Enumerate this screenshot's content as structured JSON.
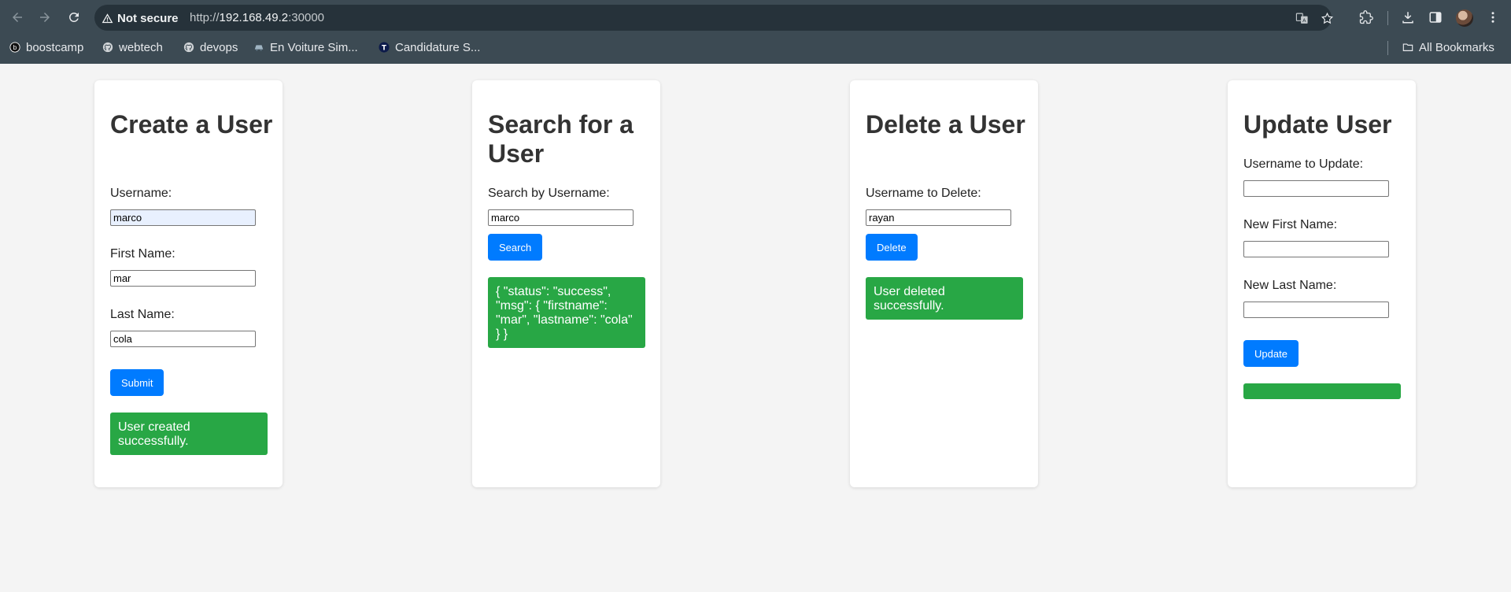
{
  "browser": {
    "security_label": "Not secure",
    "url_scheme": "http://",
    "url_host": "192.168.49.2",
    "url_port": ":30000",
    "bookmarks": [
      {
        "label": "boostcamp",
        "icon": "boostcamp-icon"
      },
      {
        "label": "webtech",
        "icon": "github-icon"
      },
      {
        "label": "devops",
        "icon": "github-icon"
      },
      {
        "label": "En Voiture Sim...",
        "icon": "train-icon"
      },
      {
        "label": "Candidature S...",
        "icon": "t-logo-icon"
      }
    ],
    "all_bookmarks_label": "All Bookmarks"
  },
  "create": {
    "title": "Create a User",
    "username_label": "Username:",
    "username_value": "marco",
    "firstname_label": "First Name:",
    "firstname_value": "mar",
    "lastname_label": "Last Name:",
    "lastname_value": "cola",
    "submit_label": "Submit",
    "message": "User created successfully."
  },
  "search": {
    "title": "Search for a User",
    "username_label": "Search by Username:",
    "username_value": "marco",
    "button_label": "Search",
    "result": "{ \"status\": \"success\", \"msg\": { \"firstname\": \"mar\", \"lastname\": \"cola\" } }"
  },
  "delete": {
    "title": "Delete a User",
    "username_label": "Username to Delete:",
    "username_value": "rayan",
    "button_label": "Delete",
    "message": "User deleted successfully."
  },
  "update": {
    "title": "Update User",
    "username_label": "Username to Update:",
    "username_value": "",
    "firstname_label": "New First Name:",
    "firstname_value": "",
    "lastname_label": "New Last Name:",
    "lastname_value": "",
    "button_label": "Update",
    "message": ""
  }
}
